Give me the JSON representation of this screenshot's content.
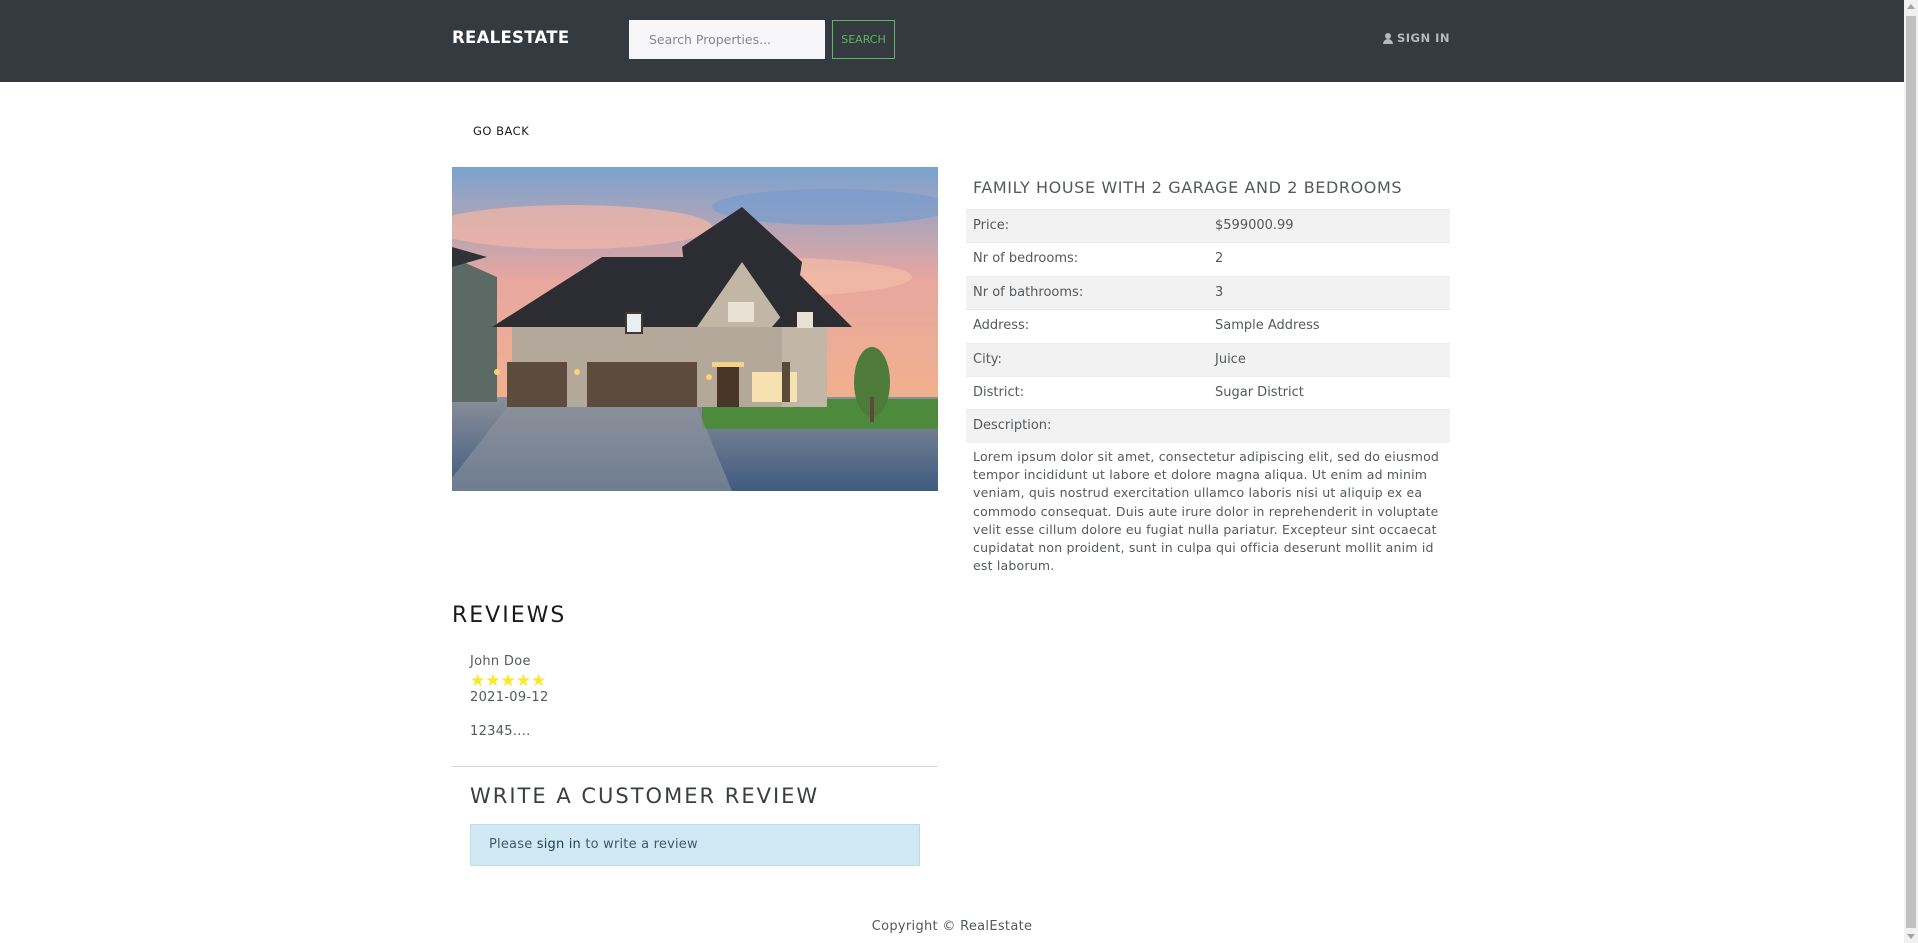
{
  "navbar": {
    "brand": "REALESTATE",
    "search_placeholder": "Search Properties...",
    "search_button": "SEARCH",
    "signin": "SIGN IN"
  },
  "go_back": "GO BACK",
  "property": {
    "title": "FAMILY HOUSE WITH 2 GARAGE AND 2 BEDROOMS",
    "details": [
      {
        "label": "Price:",
        "value": "$599000.99"
      },
      {
        "label": "Nr of bedrooms:",
        "value": "2"
      },
      {
        "label": "Nr of bathrooms:",
        "value": "3"
      },
      {
        "label": "Address:",
        "value": "Sample Address"
      },
      {
        "label": "City:",
        "value": "Juice"
      },
      {
        "label": "District:",
        "value": "Sugar District"
      },
      {
        "label": "Description:",
        "value": ""
      }
    ],
    "description": "Lorem ipsum dolor sit amet, consectetur adipiscing elit, sed do eiusmod tempor incididunt ut labore et dolore magna aliqua. Ut enim ad minim veniam, quis nostrud exercitation ullamco laboris nisi ut aliquip ex ea commodo consequat. Duis aute irure dolor in reprehenderit in voluptate velit esse cillum dolore eu fugiat nulla pariatur. Excepteur sint occaecat cupidatat non proident, sunt in culpa qui officia deserunt mollit anim id est laborum."
  },
  "reviews": {
    "heading": "REVIEWS",
    "items": [
      {
        "name": "John Doe",
        "rating": 5,
        "date": "2021-09-12",
        "comment": "12345...."
      }
    ]
  },
  "write_review": {
    "heading": "WRITE A CUSTOMER REVIEW",
    "alert_prefix": "Please ",
    "alert_link": "sign in",
    "alert_suffix": " to write a review"
  },
  "footer": "Copyright © RealEstate",
  "colors": {
    "navbar_bg": "#343a40",
    "search_button": "#5cb85c",
    "star": "#f8e825",
    "alert_bg": "#d1e9f4"
  }
}
